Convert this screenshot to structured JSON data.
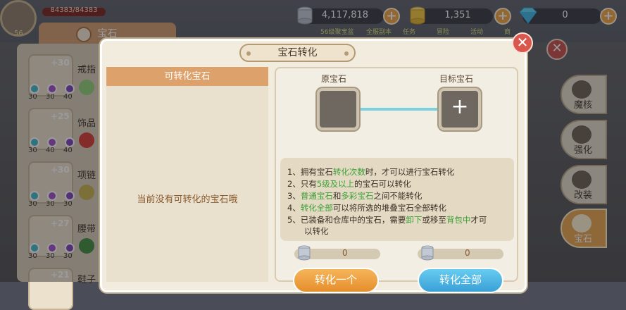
{
  "player": {
    "hp": "84383/84383",
    "level": "56"
  },
  "currency": {
    "silver": "4,117,818",
    "gold": "1,351",
    "diamond": "0"
  },
  "top_labels": [
    "56级聚宝盆",
    "全服副本",
    "任务",
    "冒险",
    "活动",
    "商"
  ],
  "bg_panel": {
    "title": "宝石",
    "slots": [
      {
        "level": "+30",
        "name": "戒指",
        "gems": [
          "30",
          "30",
          "40"
        ]
      },
      {
        "level": "+25",
        "name": "饰品",
        "gems": [
          "30",
          "40",
          "40"
        ]
      },
      {
        "level": "+30",
        "name": "项链",
        "gems": [
          "30",
          "30",
          "30"
        ]
      },
      {
        "level": "+27",
        "name": "腰带",
        "gems": [
          "30",
          "30",
          "30"
        ]
      },
      {
        "level": "+21",
        "name": "鞋子",
        "gems": []
      }
    ]
  },
  "right_menu": [
    {
      "label": "魔核"
    },
    {
      "label": "强化"
    },
    {
      "label": "改装"
    },
    {
      "label": "宝石"
    }
  ],
  "dialog": {
    "title": "宝石转化",
    "list_header": "可转化宝石",
    "empty_text": "当前没有可转化的宝石哦",
    "source_label": "原宝石",
    "target_label": "目标宝石",
    "rules": [
      {
        "prefix": "1、拥有宝石",
        "hl": "转化次数",
        "suffix": "时，才可以进行宝石转化"
      },
      {
        "prefix": "2、只有",
        "hl": "5级及以上",
        "suffix": "的宝石可以转化"
      },
      {
        "prefix": "3、",
        "hl": "普通宝石",
        "mid": "和",
        "hl2": "多彩宝石",
        "suffix": "之间不能转化"
      },
      {
        "prefix": "4、",
        "hl": "转化全部",
        "suffix": "可以将所选的堆叠宝石全部转化"
      },
      {
        "prefix": "5、已装备和仓库中的宝石，需要",
        "hl": "卸下",
        "mid": "或移至",
        "hl2": "背包中",
        "suffix": "才可"
      }
    ],
    "rule5_cont": "以转化",
    "cost_one": "0",
    "cost_all": "0",
    "btn_one": "转化一个",
    "btn_all": "转化全部"
  }
}
